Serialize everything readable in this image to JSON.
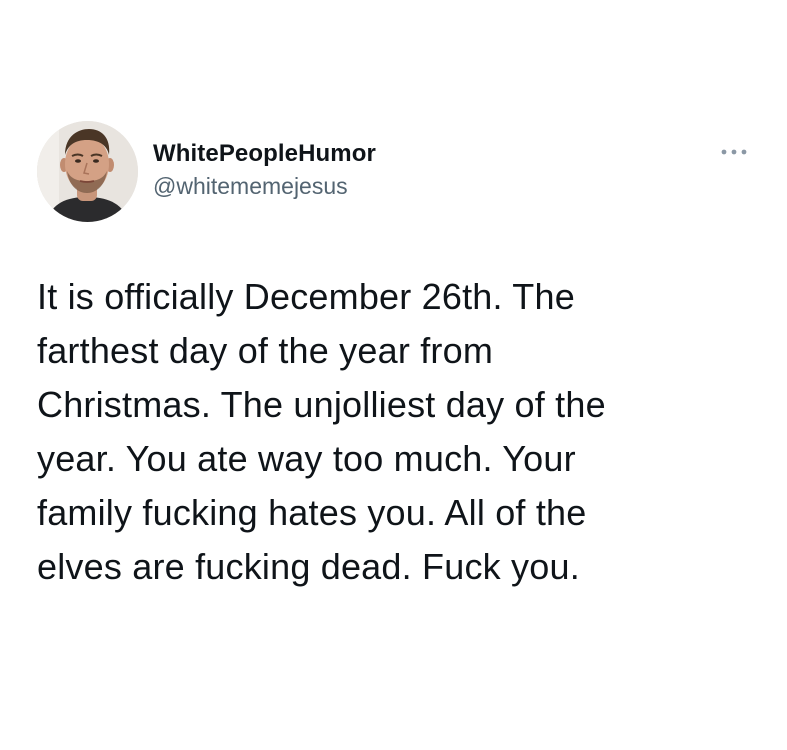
{
  "tweet": {
    "author": {
      "display_name": "WhitePeopleHumor",
      "handle": "@whitememejesus",
      "avatar_icon": "profile-photo"
    },
    "more_icon": "more-horizontal-icon",
    "text": "It is officially December 26th. The\nfarthest day of the year from\nChristmas. The unjolliest day of the\nyear. You ate way too much. Your\nfamily fucking hates you. All of the\nelves are fucking dead. Fuck you."
  },
  "colors": {
    "text_primary": "#0f1419",
    "text_secondary": "#536471",
    "background": "#ffffff"
  }
}
